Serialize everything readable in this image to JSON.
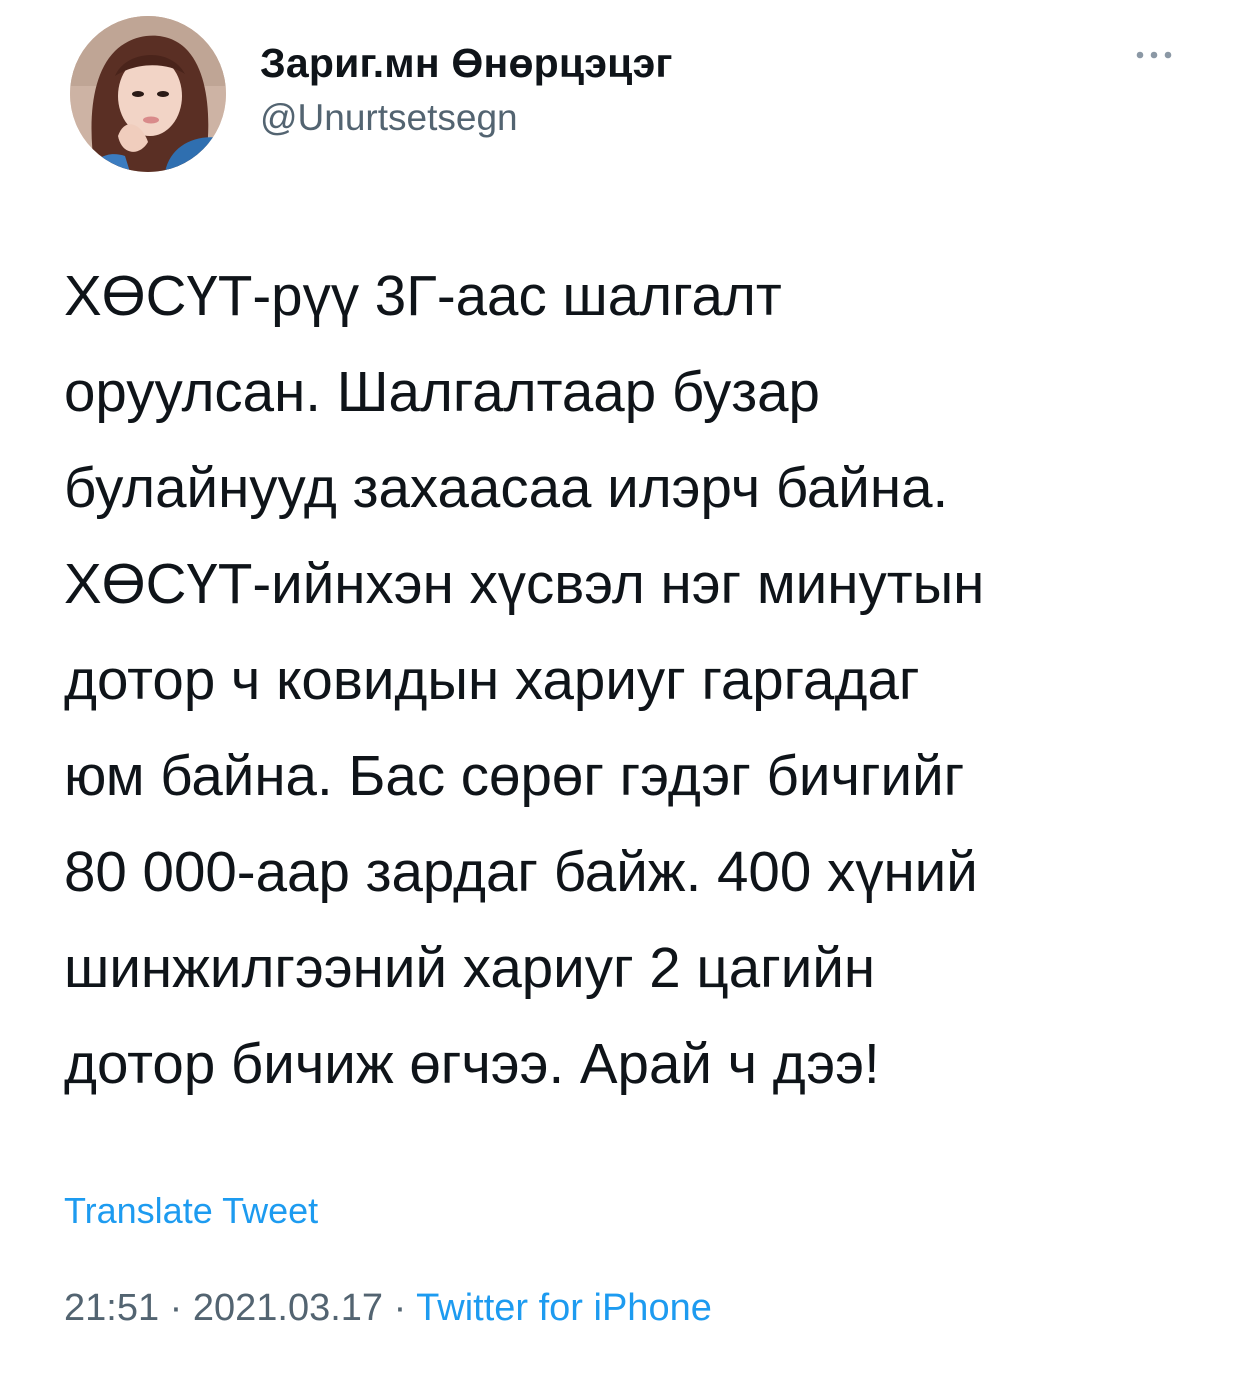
{
  "tweet": {
    "author": {
      "display_name": "Зариг.мн Өнөрцэцэг",
      "handle": "@Unurtsetsegn"
    },
    "text": "ХӨСҮТ-рүү 3Г-аас шалгалт\nоруулсан. Шалгалтаар бузар\nбулайнууд захаасаа илэрч байна.\nХӨСҮТ-ийнхэн хүсвэл нэг минутын\nдотор ч ковидын хариуг гаргадаг\nюм байна. Бас сөрөг гэдэг бичгийг\n80 000-аар зардаг байж. 400 хүний\nшинжилгээний хариуг 2 цагийн\nдотор бичиж өгчээ. Арай ч дээ!",
    "translate_label": "Translate Tweet",
    "time": "21:51",
    "date": "2021.03.17",
    "separator": "·",
    "source": "Twitter for iPhone"
  },
  "icons": {
    "more": "more-horizontal-icon",
    "avatar": "profile-photo"
  },
  "colors": {
    "text": "#0f1419",
    "secondary": "#536471",
    "accent": "#1d9bf0",
    "background": "#ffffff"
  }
}
